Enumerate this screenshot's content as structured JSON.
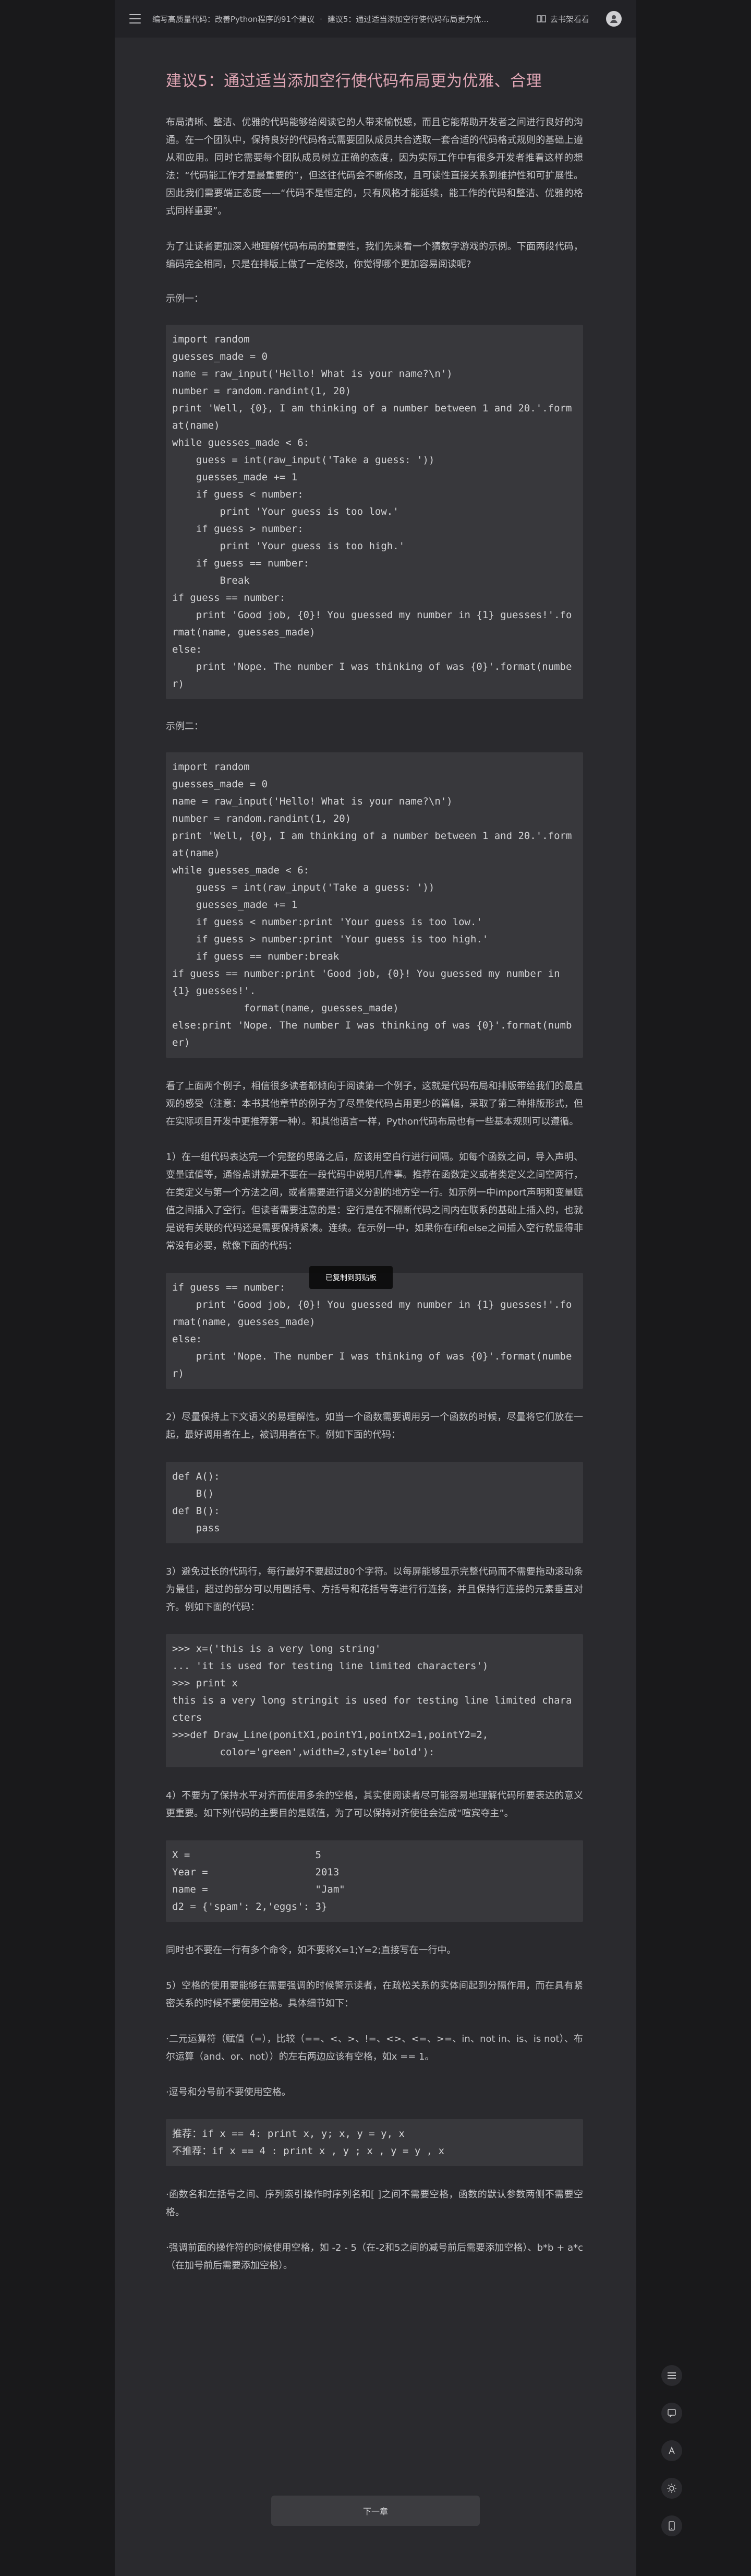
{
  "header": {
    "crumbs": [
      "编写高质量代码：改善Python程序的91个建议",
      "建议5：通过适当添加空行使代码布局更为优雅、合理"
    ],
    "read_label": "去书架看看"
  },
  "article": {
    "title": "建议5：通过适当添加空行使代码布局更为优雅、合理",
    "p1": "布局清晰、整洁、优雅的代码能够给阅读它的人带来愉悦感，而且它能帮助开发者之间进行良好的沟通。在一个团队中，保持良好的代码格式需要团队成员共合选取一套合适的代码格式规则的基础上遵从和应用。同时它需要每个团队成员树立正确的态度，因为实际工作中有很多开发者推看这样的想法：“代码能工作才是最重要的”，但这往代码会不断修改，且可读性直接关系到维护性和可扩展性。因此我们需要端正态度——“代码不是恒定的，只有风格才能延续，能工作的代码和整洁、优雅的格式同样重要”。",
    "p2": "为了让读者更加深入地理解代码布局的重要性，我们先来看一个猜数字游戏的示例。下面两段代码，编码完全相同，只是在排版上做了一定修改，你觉得哪个更加容易阅读呢?",
    "label1": "示例一：",
    "code1": "import random\nguesses_made = 0\nname = raw_input('Hello! What is your name?\\n')\nnumber = random.randint(1, 20)\nprint 'Well, {0}, I am thinking of a number between 1 and 20.'.format(name)\nwhile guesses_made < 6:\n    guess = int(raw_input('Take a guess: '))\n    guesses_made += 1\n    if guess < number:\n        print 'Your guess is too low.'\n    if guess > number:\n        print 'Your guess is too high.'\n    if guess == number:\n        Break\nif guess == number:\n    print 'Good job, {0}! You guessed my number in {1} guesses!'.format(name, guesses_made)\nelse:\n    print 'Nope. The number I was thinking of was {0}'.format(number)",
    "label2": "示例二：",
    "code2": "import random\nguesses_made = 0\nname = raw_input('Hello! What is your name?\\n')\nnumber = random.randint(1, 20)\nprint 'Well, {0}, I am thinking of a number between 1 and 20.'.format(name)\nwhile guesses_made < 6:\n    guess = int(raw_input('Take a guess: '))\n    guesses_made += 1\n    if guess < number:print 'Your guess is too low.'\n    if guess > number:print 'Your guess is too high.'\n    if guess == number:break\nif guess == number:print 'Good job, {0}! You guessed my number in {1} guesses!'.\n            format(name, guesses_made)\nelse:print 'Nope. The number I was thinking of was {0}'.format(number)",
    "p3": "看了上面两个例子，相信很多读者都倾向于阅读第一个例子，这就是代码布局和排版带给我们的最直观的感受（注意：本书其他章节的例子为了尽量使代码占用更少的篇幅，采取了第二种排版形式，但在实际项目开发中更推荐第一种）。和其他语言一样，Python代码布局也有一些基本规则可以遵循。",
    "p4": "1）在一组代码表达完一个完整的思路之后，应该用空白行进行间隔。如每个函数之间，导入声明、变量赋值等，通俗点讲就是不要在一段代码中说明几件事。推荐在函数定义或者类定义之间空两行，在类定义与第一个方法之间，或者需要进行语义分割的地方空一行。如示例一中import声明和变量赋值之间插入了空行。但读者需要注意的是：空行是在不隔断代码之间内在联系的基础上插入的，也就是说有关联的代码还是需要保持紧凑。连续。在示例一中，如果你在if和else之间插入空行就显得非常没有必要，就像下面的代码：",
    "code3": "if guess == number:\n    print 'Good job, {0}! You guessed my number in {1} guesses!'.format(name, guesses_made)\nelse:\n    print 'Nope. The number I was thinking of was {0}'.format(number)",
    "p5": "2）尽量保持上下文语义的易理解性。如当一个函数需要调用另一个函数的时候，尽量将它们放在一起，最好调用者在上，被调用者在下。例如下面的代码：",
    "code4": "def A():\n    B()\ndef B():\n    pass",
    "p6": "3）避免过长的代码行，每行最好不要超过80个字符。以每屏能够显示完整代码而不需要拖动滚动条为最佳，超过的部分可以用圆括号、方括号和花括号等进行行连接，并且保持行连接的元素垂直对齐。例如下面的代码：",
    "code5": ">>> x=('this is a very long string'\n... 'it is used for testing line limited characters')\n>>> print x\nthis is a very long stringit is used for testing line limited characters\n>>>def Draw_Line(ponitX1,pointY1,pointX2=1,pointY2=2,\n        color='green',width=2,style='bold'):",
    "p7": "4）不要为了保持水平对齐而使用多余的空格，其实使阅读者尽可能容易地理解代码所要表达的意义更重要。如下列代码的主要目的是赋值，为了可以保持对齐使往会造成“喧宾夺主”。",
    "code6": "X =                     5\nYear =                  2013\nname =                  \"Jam\"\nd2 = {'spam': 2,'eggs': 3}",
    "p8": "同时也不要在一行有多个命令，如不要将X=1;Y=2;直接写在一行中。",
    "p9": "5）空格的使用要能够在需要强调的时候警示读者，在疏松关系的实体间起到分隔作用，而在具有紧密关系的时候不要使用空格。具体细节如下：",
    "p10": "·二元运算符（赋值（=），比较（==、<、>、!=、<>、<=、>=、in、not in、is、is not）、布尔运算（and、or、not））的左右两边应该有空格，如x == 1。",
    "p11": "·逗号和分号前不要使用空格。",
    "code7": "推荐：if x == 4: print x, y; x, y = y, x\n不推荐：if x == 4 : print x , y ; x , y = y , x",
    "p12": "·函数名和左括号之间、序列索引操作时序列名和[ ]之间不需要空格，函数的默认参数两侧不需要空格。",
    "p13": "·强调前面的操作符的时候使用空格，如 -2 - 5（在-2和5之间的减号前后需要添加空格）、b*b + a*c（在加号前后需要添加空格）。",
    "toast": "已复制到剪贴板",
    "next_label": "下一章"
  }
}
